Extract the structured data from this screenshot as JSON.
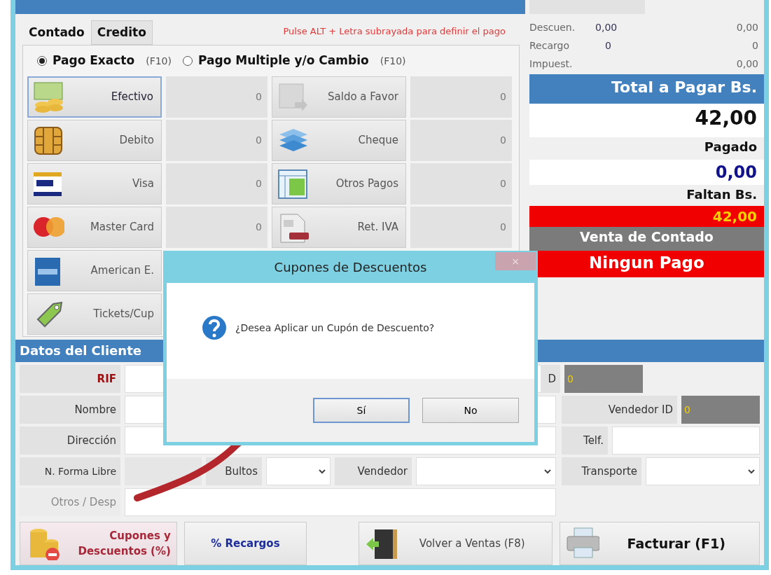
{
  "payment": {
    "tabs": [
      {
        "label": "Contado",
        "selected": true
      },
      {
        "label": "Credito",
        "selected": false
      }
    ],
    "hint": "Pulse ALT + Letra subrayada para definir el pago",
    "modes": [
      {
        "label": "Pago Exacto",
        "key": "(F10)",
        "selected": true
      },
      {
        "label": "Pago Multiple y/o Cambio",
        "key": "(F10)",
        "selected": false
      }
    ],
    "methods_left": [
      {
        "label": "Efectivo",
        "amount": "0",
        "kind": "cash",
        "focused": true
      },
      {
        "label": "Debito",
        "amount": "0",
        "kind": "chip",
        "focused": false
      },
      {
        "label": "Visa",
        "amount": "0",
        "kind": "visa",
        "focused": false
      },
      {
        "label": "Master Card",
        "amount": "0",
        "kind": "mastercard",
        "focused": false
      },
      {
        "label": "American E.",
        "kind": "amex",
        "focused": false
      },
      {
        "label": "Tickets/Cup",
        "kind": "tag",
        "focused": false
      }
    ],
    "methods_right": [
      {
        "label": "Saldo a Favor",
        "amount": "0",
        "kind": "transfer",
        "focused": false
      },
      {
        "label": "Cheque",
        "amount": "0",
        "kind": "stack",
        "focused": false
      },
      {
        "label": "Otros Pagos",
        "amount": "0",
        "kind": "window",
        "focused": false
      },
      {
        "label": "Ret. IVA",
        "amount": "0",
        "kind": "document",
        "focused": false
      }
    ]
  },
  "summary": {
    "rows": [
      {
        "label": "Descuen.",
        "rate": "0,00",
        "amount": "0,00"
      },
      {
        "label": "Recargo",
        "rate": "0",
        "amount": "0"
      },
      {
        "label": "Impuest.",
        "amount": "0,00"
      }
    ],
    "total_label": "Total a Pagar Bs.",
    "total": "42,00",
    "paid_label": "Pagado",
    "paid": "0,00",
    "due_label": "Faltan Bs.",
    "due": "42,00",
    "sale_type": "Venta de Contado",
    "payment_status": "Ningun Pago"
  },
  "client": {
    "title": "Datos del Cliente",
    "fields": [
      {
        "label": "RIF",
        "required": true
      },
      {
        "label": "Nombre",
        "required": false
      },
      {
        "label": "Dirección",
        "required": false
      }
    ],
    "client_id": {
      "label": "D",
      "value": "0"
    },
    "seller_id": {
      "label": "Vendedor ID",
      "value": "0"
    },
    "phone": {
      "label": "Telf."
    },
    "free_form": {
      "label": "N. Forma Libre"
    },
    "packages": {
      "label": "Bultos"
    },
    "seller": {
      "label": "Vendedor"
    },
    "transport": {
      "label": "Transporte"
    },
    "other": {
      "label": "Otros / Desp"
    }
  },
  "actions": [
    {
      "label": "Cupones y Descuentos (%)",
      "kind": "coupons"
    },
    {
      "label": "% Recargos",
      "kind": "surcharge"
    },
    {
      "label": "Volver a Ventas (F8)",
      "kind": "back"
    },
    {
      "label": "Facturar (F1)",
      "kind": "invoice"
    }
  ],
  "dialog": {
    "title": "Cupones de Descuentos",
    "close": "×",
    "message": "¿Desea Aplicar un Cupón de Descuento?",
    "buttons": [
      {
        "label": "Sí",
        "selected": true
      },
      {
        "label": "No",
        "selected": false
      }
    ]
  }
}
